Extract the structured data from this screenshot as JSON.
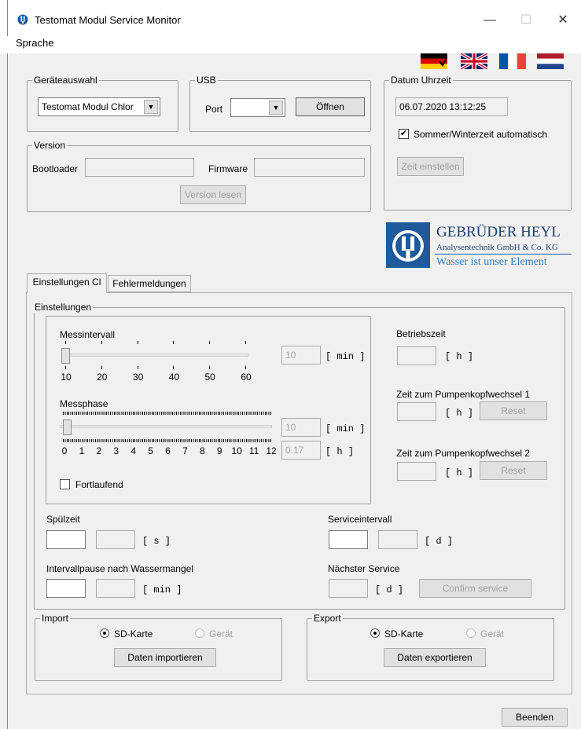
{
  "window": {
    "title": "Testomat Modul Service Monitor",
    "minimize_glyph": "—",
    "maximize_glyph": "☐",
    "close_glyph": "✕"
  },
  "menu": {
    "language": "Sprache"
  },
  "flags": [
    "flag-germany",
    "flag-uk",
    "flag-france",
    "flag-netherlands"
  ],
  "device_select": {
    "legend": "Geräteauswahl",
    "value": "Testomat Modul Chlor"
  },
  "usb": {
    "legend": "USB",
    "port_label": "Port",
    "port_value": "",
    "open_button": "Öffnen"
  },
  "datetime": {
    "legend": "Datum Uhrzeit",
    "value": "06.07.2020   13:12:25",
    "dst_label": "Sommer/Winterzeit automatisch",
    "dst_checked": true,
    "set_time_button": "Zeit einstellen"
  },
  "version": {
    "legend": "Version",
    "bootloader_label": "Bootloader",
    "bootloader_value": "",
    "firmware_label": "Firmware",
    "firmware_value": "",
    "read_button": "Version lesen"
  },
  "logo": {
    "company": "GEBRÜDER HEYL",
    "subtitle": "Analysentechnik GmbH & Co. KG",
    "slogan": "Wasser ist unser Element",
    "brand_color": "#1f5a9c"
  },
  "tabs": [
    {
      "label": "Einstellungen Cl",
      "active": true
    },
    {
      "label": "Fehlermeldungen",
      "active": false
    }
  ],
  "settings": {
    "legend": "Einstellungen",
    "interval": {
      "label": "Messintervall",
      "value": "10",
      "unit": "[ min ]",
      "ticks": [
        "10",
        "20",
        "30",
        "40",
        "50",
        "60"
      ],
      "slider_fraction": 0
    },
    "phase": {
      "label": "Messphase",
      "value_min": "10",
      "unit_min": "[ min ]",
      "value_h": "0.17",
      "unit_h": "[ h ]",
      "ticks": [
        "0",
        "1",
        "2",
        "3",
        "4",
        "5",
        "6",
        "7",
        "8",
        "9",
        "10",
        "11",
        "12"
      ],
      "slider_fraction": 0.0
    },
    "continuous_label": "Fortlaufend",
    "continuous_checked": false,
    "operating_time": {
      "label": "Betriebszeit",
      "value": "",
      "unit": "[ h ]"
    },
    "pump1": {
      "label": "Zeit zum Pumpenkopfwechsel 1",
      "value": "",
      "unit": "[ h ]",
      "reset": "Reset"
    },
    "pump2": {
      "label": "Zeit zum Pumpenkopfwechsel 2",
      "value": "",
      "unit": "[ h ]",
      "reset": "Reset"
    },
    "rinse": {
      "label": "Spülzeit",
      "value_edit": "",
      "value_read": "",
      "unit": "[ s ]"
    },
    "pause": {
      "label": "Intervallpause nach Wassermangel",
      "value_edit": "",
      "value_read": "",
      "unit": "[ min ]"
    },
    "service_interval": {
      "label": "Serviceintervall",
      "value_edit": "",
      "value_read": "",
      "unit": "[ d ]"
    },
    "next_service": {
      "label": "Nächster Service",
      "value": "",
      "unit": "[ d ]",
      "confirm": "Confirm service"
    }
  },
  "import": {
    "legend": "Import",
    "sd_label": "SD-Karte",
    "device_label": "Gerät",
    "sd_selected": true,
    "button": "Daten importieren"
  },
  "export": {
    "legend": "Export",
    "sd_label": "SD-Karte",
    "device_label": "Gerät",
    "sd_selected": true,
    "button": "Daten exportieren"
  },
  "exit_button": "Beenden"
}
